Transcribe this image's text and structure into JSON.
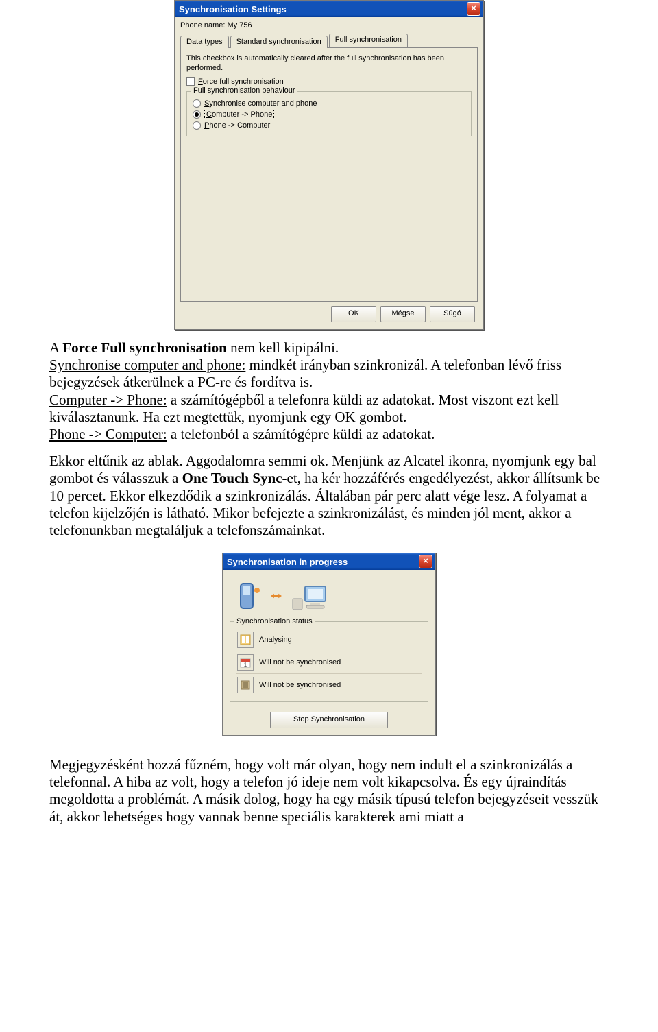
{
  "win1": {
    "title": "Synchronisation Settings",
    "phone_name": "Phone name: My 756",
    "tabs": {
      "data_types": "Data types",
      "standard": "Standard synchronisation",
      "full": "Full synchronisation"
    },
    "info": "This checkbox is automatically cleared after the full synchronisation has been performed.",
    "force_full": "Force full synchronisation",
    "group_legend": "Full synchronisation behaviour",
    "radios": {
      "both": "Synchronise computer and phone",
      "c2p": "Computer -> Phone",
      "p2c": "Phone -> Computer"
    },
    "buttons": {
      "ok": "OK",
      "cancel": "Mégse",
      "help": "Súgó"
    }
  },
  "body": {
    "p1": {
      "s1a": "A ",
      "s1b": "Force Full synchronisation",
      "s1c": " nem kell kipipálni.",
      "s2a": "Synchronise computer and phone:",
      "s2b": " mindkét irányban szinkronizál. A telefonban lévő friss bejegyzések átkerülnek a PC-re és fordítva is.",
      "s3a": "Computer -> Phone:",
      "s3b": " a számítógépből a telefonra küldi az adatokat. Most viszont ezt kell kiválasztanunk. Ha ezt megtettük, nyomjunk egy OK gombot.",
      "s4a": "Phone -> Computer:",
      "s4b": " a telefonból a számítógépre küldi az adatokat."
    },
    "p2a": "Ekkor eltűnik az ablak. Aggodalomra semmi ok. Menjünk az Alcatel ikonra, nyomjunk egy bal gombot és válasszuk a ",
    "p2b": "One Touch Sync",
    "p2c": "-et, ha kér hozzáférés engedélyezést, akkor állítsunk be 10 percet. Ekkor elkezdődik a szinkronizálás. Általában pár perc alatt vége lesz. A folyamat a telefon kijelzőjén is látható. Mikor befejezte a szinkronizálást, és minden jól ment, akkor a telefonunkban megtaláljuk a telefonszámainkat.",
    "p3": "Megjegyzésként hozzá fűzném, hogy volt már olyan, hogy nem indult el a szinkronizálás a telefonnal. A hiba az volt, hogy a telefon jó ideje nem volt kikapcsolva. És egy újraindítás megoldotta a problémát. A másik dolog, hogy ha egy másik típusú telefon bejegyzéseit vesszük át, akkor lehetséges hogy vannak benne speciális karakterek ami miatt a"
  },
  "win2": {
    "title": "Synchronisation in progress",
    "legend": "Synchronisation status",
    "items": {
      "analysing": "Analysing",
      "not1": "Will not be synchronised",
      "not2": "Will not be synchronised"
    },
    "stop": "Stop Synchronisation"
  }
}
